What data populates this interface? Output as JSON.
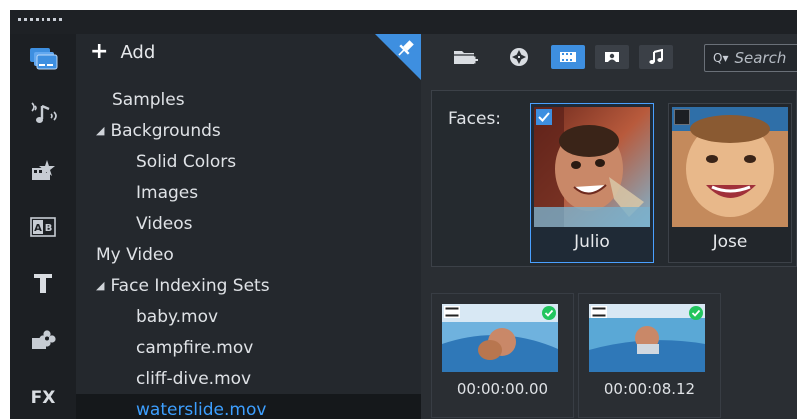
{
  "toolbar": {
    "add_label": "Add",
    "search_placeholder": "Search"
  },
  "library": {
    "items": [
      {
        "label": "Samples",
        "level": 1,
        "expander": ""
      },
      {
        "label": "Backgrounds",
        "level": 0,
        "expander": "◢"
      },
      {
        "label": "Solid Colors",
        "level": 2,
        "expander": ""
      },
      {
        "label": "Images",
        "level": 2,
        "expander": ""
      },
      {
        "label": "Videos",
        "level": 2,
        "expander": ""
      },
      {
        "label": "My Video",
        "level": 0,
        "expander": ""
      },
      {
        "label": "Face Indexing Sets",
        "level": 0,
        "expander": "◢"
      },
      {
        "label": "baby.mov",
        "level": 2,
        "expander": ""
      },
      {
        "label": "campfire.mov",
        "level": 2,
        "expander": ""
      },
      {
        "label": "cliff-dive.mov",
        "level": 2,
        "expander": ""
      },
      {
        "label": "waterslide.mov",
        "level": 2,
        "expander": "",
        "selected": true
      }
    ]
  },
  "faces": {
    "label": "Faces:",
    "people": [
      {
        "name": "Julio",
        "checked": true
      },
      {
        "name": "Jose",
        "checked": false
      }
    ]
  },
  "clips": [
    {
      "time": "00:00:00.00"
    },
    {
      "time": "00:00:08.12"
    }
  ],
  "colors": {
    "accent": "#3e8fe0",
    "selected_text": "#3d9fff",
    "checkmark": "#22c55e"
  }
}
